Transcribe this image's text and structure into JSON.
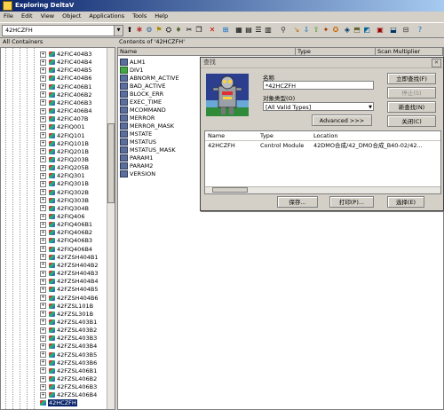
{
  "window": {
    "title": "Exploring DeltaV"
  },
  "menu": [
    "File",
    "Edit",
    "View",
    "Object",
    "Applications",
    "Tools",
    "Help"
  ],
  "toolbar": {
    "combo_value": "42HCZFH"
  },
  "left_header": "All Containers",
  "right_header": "Contents of '42HCZFH'",
  "tree_items": [
    "42FIC404B3",
    "42FIC404B4",
    "42FIC404B5",
    "42FIC404B6",
    "42FIC406B1",
    "42FIC406B2",
    "42FIC406B3",
    "42FIC406B4",
    "42FIC407B",
    "42FIQ001",
    "42FIQ101",
    "42FIQ101B",
    "42FIQ201B",
    "42FIQ203B",
    "42FIQ205B",
    "42FIQ301",
    "42FIQ301B",
    "42FIQ302B",
    "42FIQ303B",
    "42FIQ304B",
    "42FIQ406",
    "42FIQ406B1",
    "42FIQ406B2",
    "42FIQ406B3",
    "42FIQ406B4",
    "42FZSH404B1",
    "42FZSH404B2",
    "42FZSH404B3",
    "42FZSH404B4",
    "42FZSH404B5",
    "42FZSH404B6",
    "42FZSL101B",
    "42FZSL301B",
    "42FZSL403B1",
    "42FZSL403B2",
    "42FZSL403B3",
    "42FZSL403B4",
    "42FZSL403B5",
    "42FZSL403B6",
    "42FZSL406B1",
    "42FZSL406B2",
    "42FZSL406B3",
    "42FZSL406B4"
  ],
  "tree_selected": "42HCZFH",
  "list_columns": {
    "name": "Name",
    "type": "Type",
    "scan": "Scan Multiplier"
  },
  "params": [
    "ALM1",
    "DIV1",
    "ABNORM_ACTIVE",
    "BAD_ACTIVE",
    "BLOCK_ERR",
    "EXEC_TIME",
    "MCOMMAND",
    "MERROR",
    "MERROR_MASK",
    "MSTATE",
    "MSTATUS",
    "MSTATUS_MASK",
    "PARAM1",
    "PARAM2",
    "VERSION"
  ],
  "dialog": {
    "title": "查找",
    "name_label": "名称",
    "name_value": "*42HCZFH",
    "type_label": "对象类型(O)",
    "type_value": "[All Valid Types]",
    "advanced": "Advanced >>>",
    "btn_find_now": "立即查找(F)",
    "btn_stop": "停止(S)",
    "btn_new_search": "新查找(N)",
    "btn_close": "关闭(C)",
    "result_headers": {
      "name": "Name",
      "type": "Type",
      "location": "Location"
    },
    "result_row": {
      "name": "42HCZFH",
      "type": "Control Module",
      "location": "42DMO合成/42_DMO合成_B40-02/42..."
    },
    "btn_save": "保存...",
    "btn_print": "打印(P)...",
    "btn_select": "选择(E)"
  }
}
